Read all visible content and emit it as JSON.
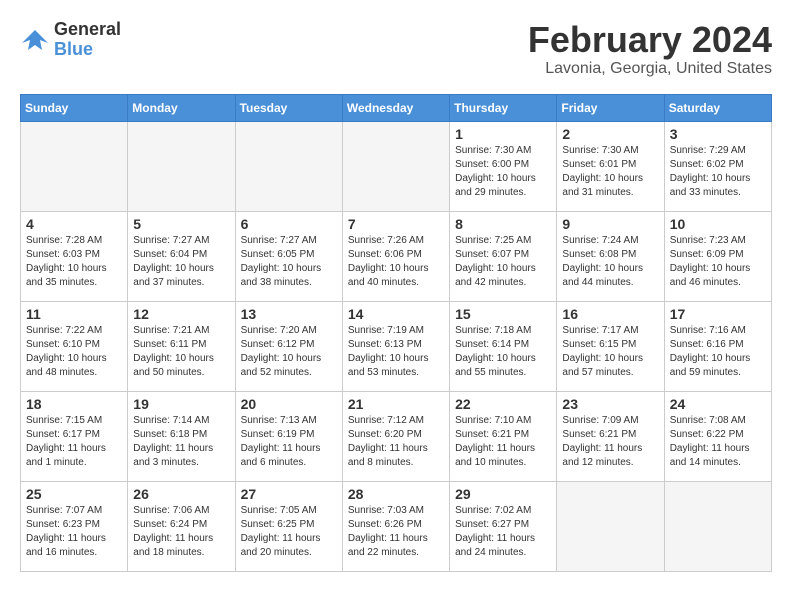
{
  "logo": {
    "general": "General",
    "blue": "Blue"
  },
  "title": "February 2024",
  "location": "Lavonia, Georgia, United States",
  "days_of_week": [
    "Sunday",
    "Monday",
    "Tuesday",
    "Wednesday",
    "Thursday",
    "Friday",
    "Saturday"
  ],
  "weeks": [
    [
      {
        "day": "",
        "empty": true
      },
      {
        "day": "",
        "empty": true
      },
      {
        "day": "",
        "empty": true
      },
      {
        "day": "",
        "empty": true
      },
      {
        "day": "1",
        "sunrise": "7:30 AM",
        "sunset": "6:00 PM",
        "daylight": "10 hours and 29 minutes."
      },
      {
        "day": "2",
        "sunrise": "7:30 AM",
        "sunset": "6:01 PM",
        "daylight": "10 hours and 31 minutes."
      },
      {
        "day": "3",
        "sunrise": "7:29 AM",
        "sunset": "6:02 PM",
        "daylight": "10 hours and 33 minutes."
      }
    ],
    [
      {
        "day": "4",
        "sunrise": "7:28 AM",
        "sunset": "6:03 PM",
        "daylight": "10 hours and 35 minutes."
      },
      {
        "day": "5",
        "sunrise": "7:27 AM",
        "sunset": "6:04 PM",
        "daylight": "10 hours and 37 minutes."
      },
      {
        "day": "6",
        "sunrise": "7:27 AM",
        "sunset": "6:05 PM",
        "daylight": "10 hours and 38 minutes."
      },
      {
        "day": "7",
        "sunrise": "7:26 AM",
        "sunset": "6:06 PM",
        "daylight": "10 hours and 40 minutes."
      },
      {
        "day": "8",
        "sunrise": "7:25 AM",
        "sunset": "6:07 PM",
        "daylight": "10 hours and 42 minutes."
      },
      {
        "day": "9",
        "sunrise": "7:24 AM",
        "sunset": "6:08 PM",
        "daylight": "10 hours and 44 minutes."
      },
      {
        "day": "10",
        "sunrise": "7:23 AM",
        "sunset": "6:09 PM",
        "daylight": "10 hours and 46 minutes."
      }
    ],
    [
      {
        "day": "11",
        "sunrise": "7:22 AM",
        "sunset": "6:10 PM",
        "daylight": "10 hours and 48 minutes."
      },
      {
        "day": "12",
        "sunrise": "7:21 AM",
        "sunset": "6:11 PM",
        "daylight": "10 hours and 50 minutes."
      },
      {
        "day": "13",
        "sunrise": "7:20 AM",
        "sunset": "6:12 PM",
        "daylight": "10 hours and 52 minutes."
      },
      {
        "day": "14",
        "sunrise": "7:19 AM",
        "sunset": "6:13 PM",
        "daylight": "10 hours and 53 minutes."
      },
      {
        "day": "15",
        "sunrise": "7:18 AM",
        "sunset": "6:14 PM",
        "daylight": "10 hours and 55 minutes."
      },
      {
        "day": "16",
        "sunrise": "7:17 AM",
        "sunset": "6:15 PM",
        "daylight": "10 hours and 57 minutes."
      },
      {
        "day": "17",
        "sunrise": "7:16 AM",
        "sunset": "6:16 PM",
        "daylight": "10 hours and 59 minutes."
      }
    ],
    [
      {
        "day": "18",
        "sunrise": "7:15 AM",
        "sunset": "6:17 PM",
        "daylight": "11 hours and 1 minute."
      },
      {
        "day": "19",
        "sunrise": "7:14 AM",
        "sunset": "6:18 PM",
        "daylight": "11 hours and 3 minutes."
      },
      {
        "day": "20",
        "sunrise": "7:13 AM",
        "sunset": "6:19 PM",
        "daylight": "11 hours and 6 minutes."
      },
      {
        "day": "21",
        "sunrise": "7:12 AM",
        "sunset": "6:20 PM",
        "daylight": "11 hours and 8 minutes."
      },
      {
        "day": "22",
        "sunrise": "7:10 AM",
        "sunset": "6:21 PM",
        "daylight": "11 hours and 10 minutes."
      },
      {
        "day": "23",
        "sunrise": "7:09 AM",
        "sunset": "6:21 PM",
        "daylight": "11 hours and 12 minutes."
      },
      {
        "day": "24",
        "sunrise": "7:08 AM",
        "sunset": "6:22 PM",
        "daylight": "11 hours and 14 minutes."
      }
    ],
    [
      {
        "day": "25",
        "sunrise": "7:07 AM",
        "sunset": "6:23 PM",
        "daylight": "11 hours and 16 minutes."
      },
      {
        "day": "26",
        "sunrise": "7:06 AM",
        "sunset": "6:24 PM",
        "daylight": "11 hours and 18 minutes."
      },
      {
        "day": "27",
        "sunrise": "7:05 AM",
        "sunset": "6:25 PM",
        "daylight": "11 hours and 20 minutes."
      },
      {
        "day": "28",
        "sunrise": "7:03 AM",
        "sunset": "6:26 PM",
        "daylight": "11 hours and 22 minutes."
      },
      {
        "day": "29",
        "sunrise": "7:02 AM",
        "sunset": "6:27 PM",
        "daylight": "11 hours and 24 minutes."
      },
      {
        "day": "",
        "empty": true
      },
      {
        "day": "",
        "empty": true
      }
    ]
  ]
}
